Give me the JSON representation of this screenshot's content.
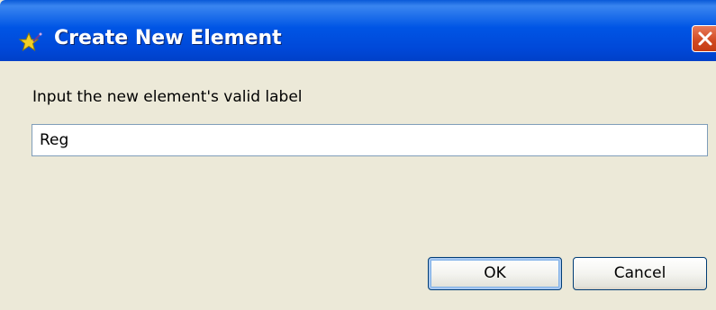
{
  "dialog": {
    "title": "Create New Element",
    "icon": "wizard-star-icon",
    "prompt": "Input the new element's valid label",
    "input_value": "Reg",
    "ok_label": "OK",
    "cancel_label": "Cancel"
  },
  "colors": {
    "titlebar": "#0055e5",
    "body": "#ece9d8",
    "close": "#d04820"
  }
}
